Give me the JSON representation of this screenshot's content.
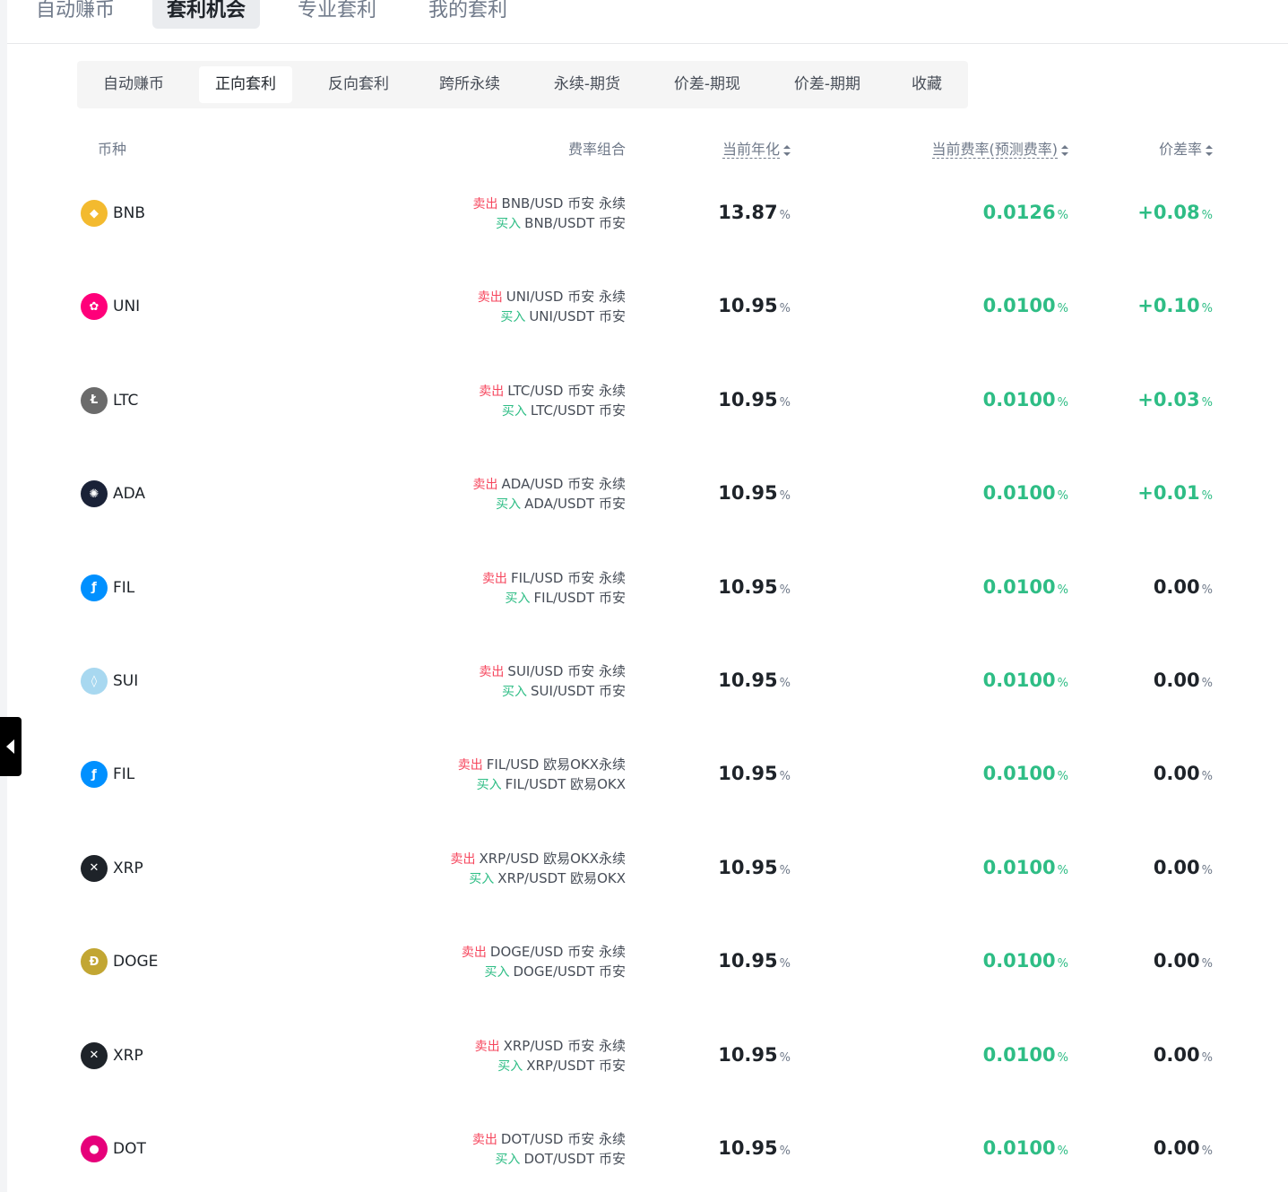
{
  "top_tabs": [
    "自动赚币",
    "套利机会",
    "专业套利",
    "我的套利"
  ],
  "sub_tabs": [
    "自动赚币",
    "正向套利",
    "反向套利",
    "跨所永续",
    "永续-期货",
    "价差-期现",
    "价差-期期",
    "收藏"
  ],
  "columns": {
    "coin": "币种",
    "combo": "费率组合",
    "annual": "当前年化",
    "rate": "当前费率(预测费率)",
    "spread": "价差率"
  },
  "percent_sign": "%",
  "rows": [
    {
      "coin": "BNB",
      "icon": "bnb-icon",
      "color": "#f3ba2f",
      "sell_label": "卖出",
      "sell": "BNB/USD 币安 永续",
      "buy_label": "买入",
      "buy": "BNB/USDT 币安",
      "annual": "13.87",
      "rate": "0.0126",
      "spread": "+0.08",
      "spread_type": "pos"
    },
    {
      "coin": "UNI",
      "icon": "uni-icon",
      "color": "#ff007a",
      "sell_label": "卖出",
      "sell": "UNI/USD 币安 永续",
      "buy_label": "买入",
      "buy": "UNI/USDT 币安",
      "annual": "10.95",
      "rate": "0.0100",
      "spread": "+0.10",
      "spread_type": "pos"
    },
    {
      "coin": "LTC",
      "icon": "ltc-icon",
      "color": "#6b6b6b",
      "sell_label": "卖出",
      "sell": "LTC/USD 币安 永续",
      "buy_label": "买入",
      "buy": "LTC/USDT 币安",
      "annual": "10.95",
      "rate": "0.0100",
      "spread": "+0.03",
      "spread_type": "pos"
    },
    {
      "coin": "ADA",
      "icon": "ada-icon",
      "color": "#1a2237",
      "sell_label": "卖出",
      "sell": "ADA/USD 币安 永续",
      "buy_label": "买入",
      "buy": "ADA/USDT 币安",
      "annual": "10.95",
      "rate": "0.0100",
      "spread": "+0.01",
      "spread_type": "pos"
    },
    {
      "coin": "FIL",
      "icon": "fil-icon",
      "color": "#0090ff",
      "sell_label": "卖出",
      "sell": "FIL/USD 币安 永续",
      "buy_label": "买入",
      "buy": "FIL/USDT 币安",
      "annual": "10.95",
      "rate": "0.0100",
      "spread": "0.00",
      "spread_type": "zero"
    },
    {
      "coin": "SUI",
      "icon": "sui-icon",
      "color": "#a8d8f0",
      "sell_label": "卖出",
      "sell": "SUI/USD 币安 永续",
      "buy_label": "买入",
      "buy": "SUI/USDT 币安",
      "annual": "10.95",
      "rate": "0.0100",
      "spread": "0.00",
      "spread_type": "zero"
    },
    {
      "coin": "FIL",
      "icon": "fil-icon",
      "color": "#0090ff",
      "sell_label": "卖出",
      "sell": "FIL/USD 欧易OKX永续",
      "buy_label": "买入",
      "buy": "FIL/USDT 欧易OKX",
      "annual": "10.95",
      "rate": "0.0100",
      "spread": "0.00",
      "spread_type": "zero"
    },
    {
      "coin": "XRP",
      "icon": "xrp-icon",
      "color": "#1e2329",
      "sell_label": "卖出",
      "sell": "XRP/USD 欧易OKX永续",
      "buy_label": "买入",
      "buy": "XRP/USDT 欧易OKX",
      "annual": "10.95",
      "rate": "0.0100",
      "spread": "0.00",
      "spread_type": "zero"
    },
    {
      "coin": "DOGE",
      "icon": "doge-icon",
      "color": "#c2a633",
      "sell_label": "卖出",
      "sell": "DOGE/USD 币安 永续",
      "buy_label": "买入",
      "buy": "DOGE/USDT 币安",
      "annual": "10.95",
      "rate": "0.0100",
      "spread": "0.00",
      "spread_type": "zero"
    },
    {
      "coin": "XRP",
      "icon": "xrp-icon",
      "color": "#1e2329",
      "sell_label": "卖出",
      "sell": "XRP/USD 币安 永续",
      "buy_label": "买入",
      "buy": "XRP/USDT 币安",
      "annual": "10.95",
      "rate": "0.0100",
      "spread": "0.00",
      "spread_type": "zero"
    },
    {
      "coin": "DOT",
      "icon": "dot-icon",
      "color": "#e6007a",
      "sell_label": "卖出",
      "sell": "DOT/USD 币安 永续",
      "buy_label": "买入",
      "buy": "DOT/USDT 币安",
      "annual": "10.95",
      "rate": "0.0100",
      "spread": "0.00",
      "spread_type": "zero"
    }
  ]
}
